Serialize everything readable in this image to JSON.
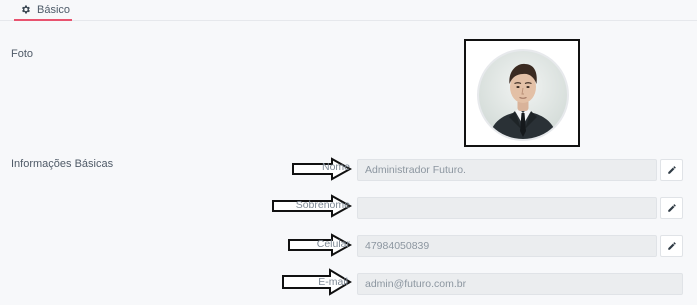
{
  "tabs": [
    {
      "label": "Básico",
      "icon": "gear-icon",
      "active": true
    }
  ],
  "sections": {
    "photo_label": "Foto",
    "basic_info_label": "Informações Básicas"
  },
  "fields": {
    "nome": {
      "label": "Nome",
      "value": "Administrador Futuro.",
      "editable": true
    },
    "sobrenome": {
      "label": "Sobrenome",
      "value": "",
      "editable": true
    },
    "celular": {
      "label": "Celular",
      "value": "47984050839",
      "editable": true
    },
    "email": {
      "label": "E-mail",
      "value": "admin@futuro.com.br",
      "editable": false
    }
  },
  "colors": {
    "active_tab_underline": "#e8536f",
    "field_background": "#ebedef",
    "photo_frame_border": "#111111"
  },
  "icons": {
    "edit": "pencil-icon",
    "annotation": "arrow-right-icon"
  }
}
